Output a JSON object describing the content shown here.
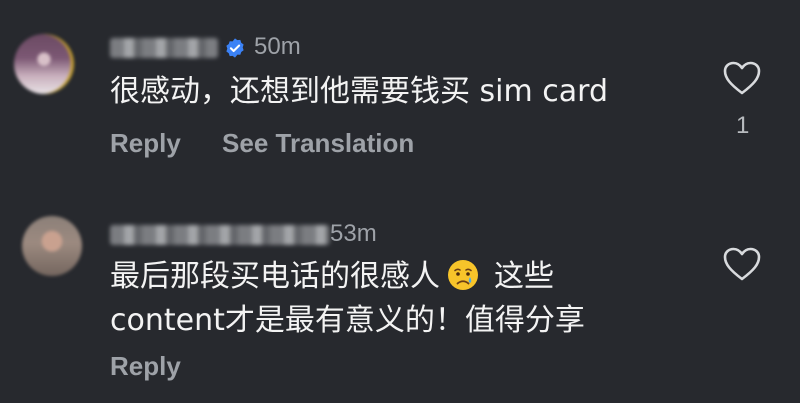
{
  "comments": [
    {
      "time": "50m",
      "text": "很感动，还想到他需要钱买 sim card",
      "actions": {
        "reply": "Reply",
        "translate": "See Translation"
      },
      "likes": "1",
      "verified": true
    },
    {
      "time": "53m",
      "text_line1": "最后那段买电话的很感人",
      "text_line1_after": "这些",
      "text_line2": "content才是最有意义的！值得分享",
      "emoji": "crying-face",
      "actions": {
        "reply": "Reply"
      }
    }
  ],
  "colors": {
    "background": "#27292e",
    "secondary_text": "#9ea2a8",
    "verified": "#3b82f6"
  }
}
